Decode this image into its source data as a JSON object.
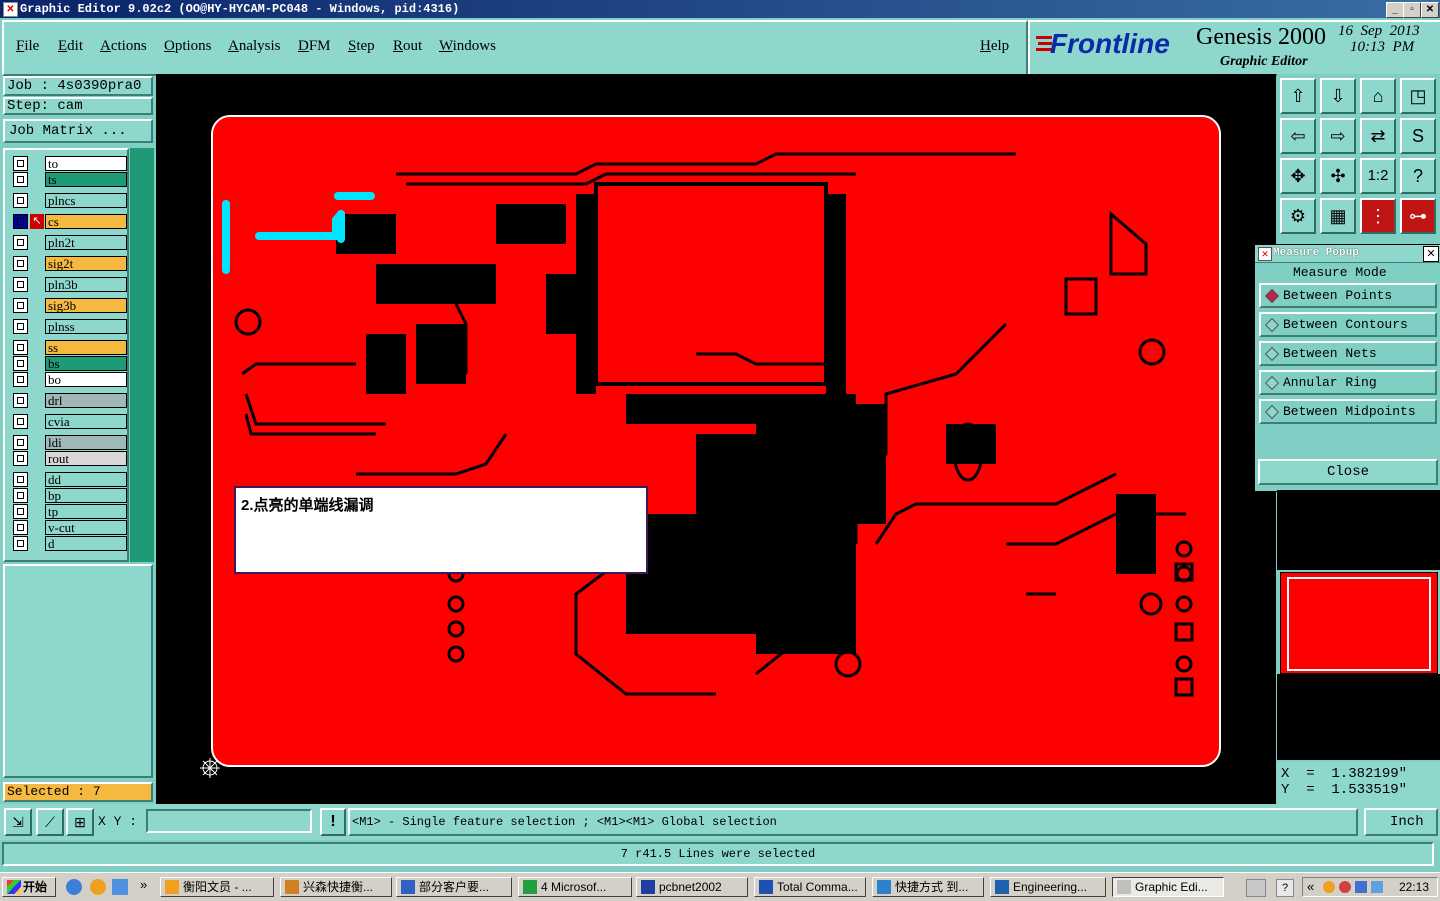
{
  "window": {
    "title": "Graphic Editor 9.02c2  (OO@HY-HYCAM-PC048 - Windows, pid:4316)"
  },
  "menu": [
    "File",
    "Edit",
    "Actions",
    "Options",
    "Analysis",
    "DFM",
    "Step",
    "Rout",
    "Windows"
  ],
  "help": "Help",
  "brand": {
    "logo": "Frontline",
    "product": "Genesis 2000",
    "subtitle": "Graphic Editor",
    "date": "16  Sep  2013",
    "time": "10:13  PM"
  },
  "job": {
    "job_label": "Job : 4s0390pra0",
    "step_label": "Step: cam",
    "matrix_button": "Job Matrix ..."
  },
  "layers": [
    {
      "name": "to",
      "color": "#ffffff"
    },
    {
      "name": "ts",
      "color": "#1e9a76"
    },
    {
      "name": "plncs",
      "color": "#8ed7cc"
    },
    {
      "name": "cs",
      "color": "#f5b942"
    },
    {
      "name": "pln2t",
      "color": "#8ed7cc"
    },
    {
      "name": "sig2t",
      "color": "#f5b942"
    },
    {
      "name": "pln3b",
      "color": "#8ed7cc"
    },
    {
      "name": "sig3b",
      "color": "#f5b942"
    },
    {
      "name": "plnss",
      "color": "#8ed7cc"
    },
    {
      "name": "ss",
      "color": "#f5b942"
    },
    {
      "name": "bs",
      "color": "#1e9a76"
    },
    {
      "name": "bo",
      "color": "#ffffff"
    },
    {
      "name": "drl",
      "color": "#a0b8b8"
    },
    {
      "name": "cvia",
      "color": "#8ed7cc"
    },
    {
      "name": "ldi",
      "color": "#a0b8b8"
    },
    {
      "name": "rout",
      "color": "#d8d8d8"
    },
    {
      "name": "dd",
      "color": "#8ed7cc"
    },
    {
      "name": "bp",
      "color": "#8ed7cc"
    },
    {
      "name": "tp",
      "color": "#8ed7cc"
    },
    {
      "name": "v-cut",
      "color": "#8ed7cc"
    },
    {
      "name": "d",
      "color": "#8ed7cc"
    }
  ],
  "selected": "Selected : 7",
  "annotation": "2.点亮的单端线漏调",
  "measure": {
    "title": "Measure Popup",
    "header": "Measure Mode",
    "options": [
      "Between Points",
      "Between Contours",
      "Between Nets",
      "Annular Ring",
      "Between Midpoints"
    ],
    "selected_index": 0,
    "close": "Close"
  },
  "coords": {
    "x": "X  =  1.382199\"",
    "y": "Y  =  1.533519\""
  },
  "xy_label": "X Y :",
  "xy_value": "",
  "hint": "<M1> - Single feature selection ; <M1><M1> Global selection",
  "units": "Inch",
  "status": "7 r41.5 Lines were selected",
  "taskbar": {
    "start": "开始",
    "tasks": [
      "衡阳文员 - ...",
      "兴森快捷衡...",
      "部分客户要...",
      "4 Microsof...",
      "pcbnet2002",
      "Total Comma...",
      "快捷方式 到...",
      "Engineering...",
      "Graphic Edi..."
    ],
    "clock": "22:13"
  },
  "colors": {
    "board": "#ff0000",
    "teal": "#8ed7cc",
    "highlight": "#00e5ff"
  }
}
